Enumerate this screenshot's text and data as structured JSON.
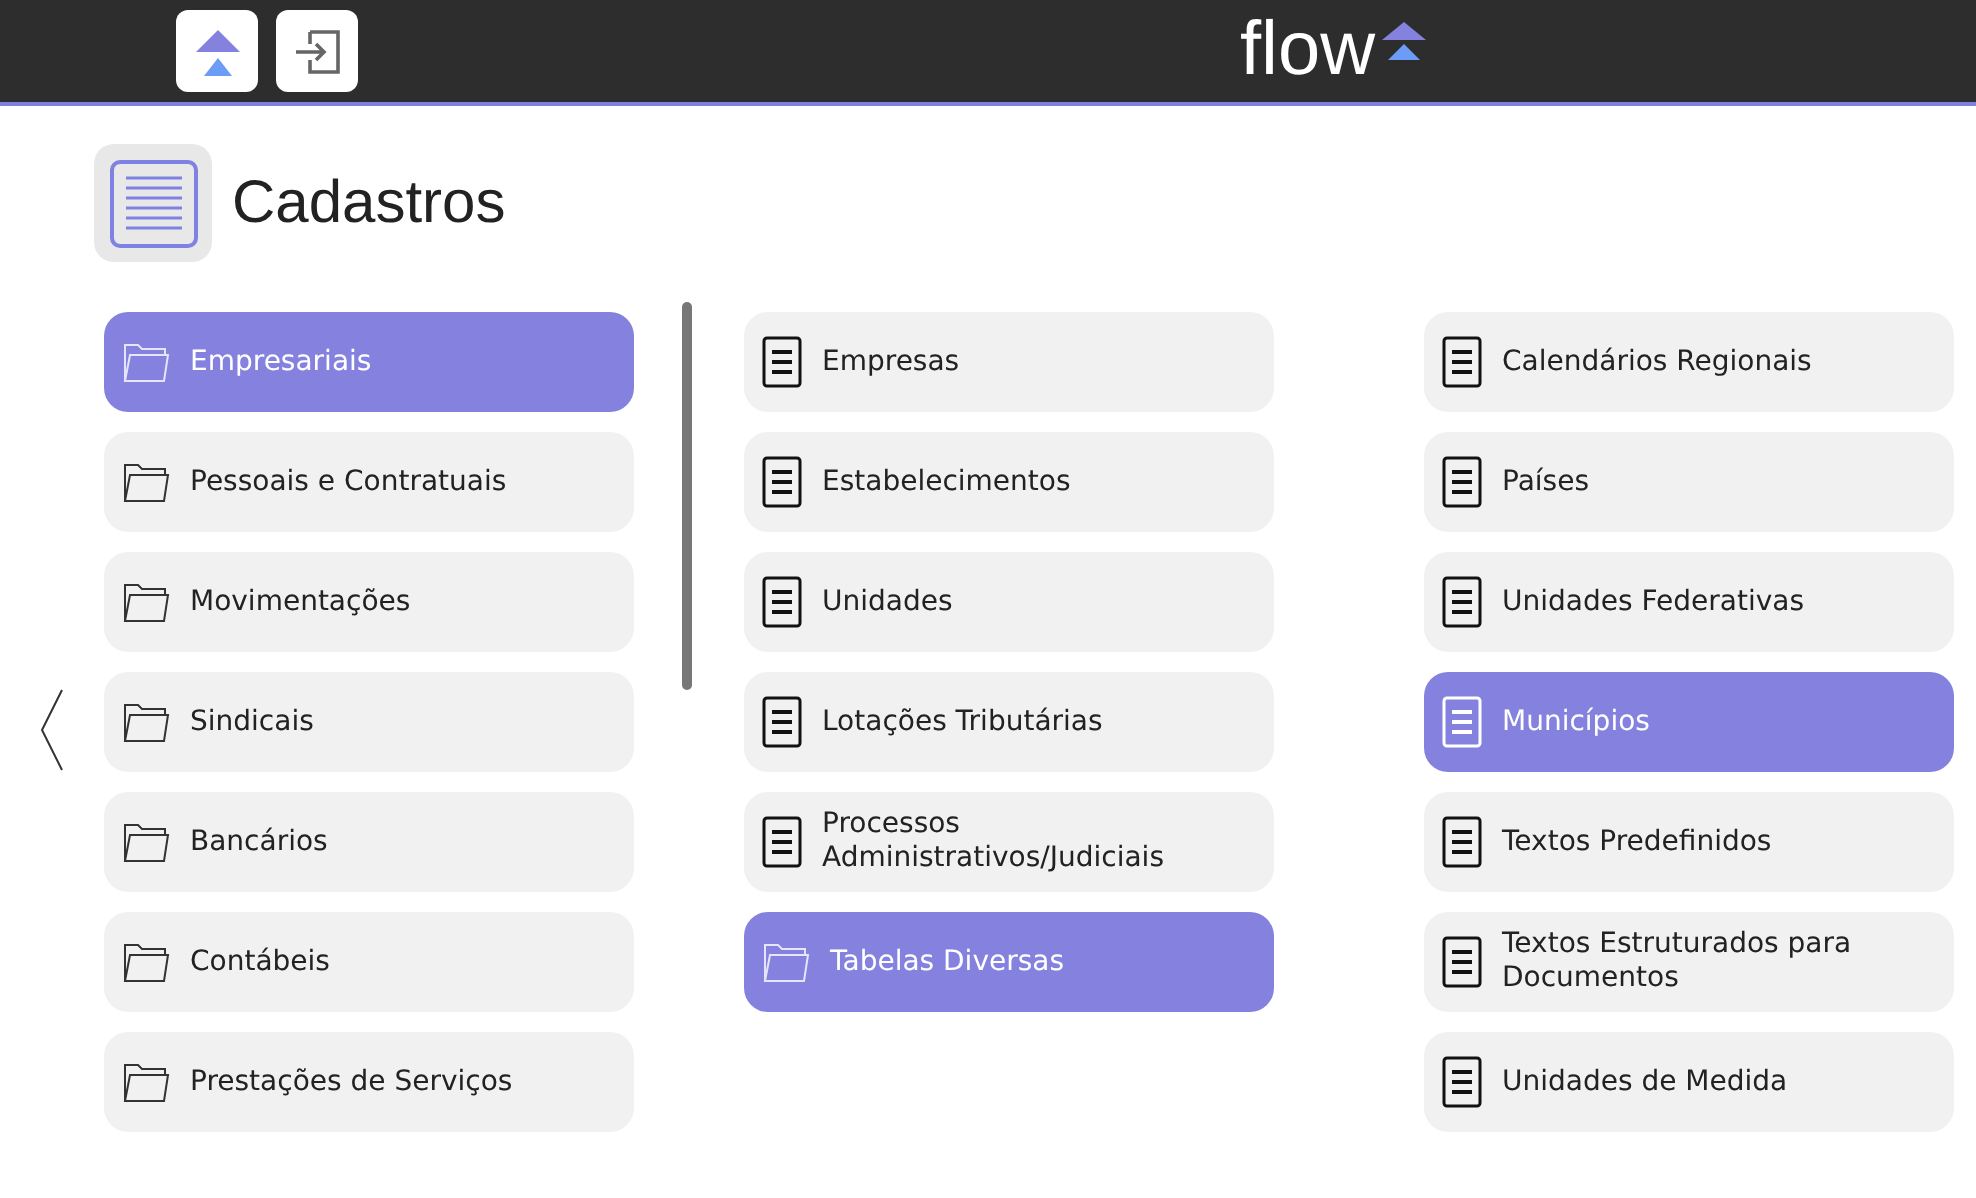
{
  "header": {
    "logo": "flow"
  },
  "page": {
    "title": "Cadastros"
  },
  "columns": [
    {
      "items": [
        {
          "label": "Empresariais",
          "kind": "folder",
          "selected": true
        },
        {
          "label": "Pessoais e Contratuais",
          "kind": "folder",
          "selected": false
        },
        {
          "label": "Movimentações",
          "kind": "folder",
          "selected": false
        },
        {
          "label": "Sindicais",
          "kind": "folder",
          "selected": false
        },
        {
          "label": "Bancários",
          "kind": "folder",
          "selected": false
        },
        {
          "label": "Contábeis",
          "kind": "folder",
          "selected": false
        },
        {
          "label": "Prestações de Serviços",
          "kind": "folder",
          "selected": false
        }
      ]
    },
    {
      "items": [
        {
          "label": "Empresas",
          "kind": "document",
          "selected": false
        },
        {
          "label": "Estabelecimentos",
          "kind": "document",
          "selected": false
        },
        {
          "label": "Unidades",
          "kind": "document",
          "selected": false
        },
        {
          "label": "Lotações Tributárias",
          "kind": "document",
          "selected": false
        },
        {
          "label": "Processos Administrativos/Judiciais",
          "kind": "document",
          "selected": false
        },
        {
          "label": "Tabelas Diversas",
          "kind": "folder",
          "selected": true
        }
      ]
    },
    {
      "items": [
        {
          "label": "Calendários Regionais",
          "kind": "document",
          "selected": false
        },
        {
          "label": "Países",
          "kind": "document",
          "selected": false
        },
        {
          "label": "Unidades Federativas",
          "kind": "document",
          "selected": false
        },
        {
          "label": "Municípios",
          "kind": "document",
          "selected": true
        },
        {
          "label": "Textos Predefinidos",
          "kind": "document",
          "selected": false
        },
        {
          "label": "Textos Estruturados para Documentos",
          "kind": "document",
          "selected": false
        },
        {
          "label": "Unidades de Medida",
          "kind": "document",
          "selected": false
        }
      ]
    }
  ]
}
